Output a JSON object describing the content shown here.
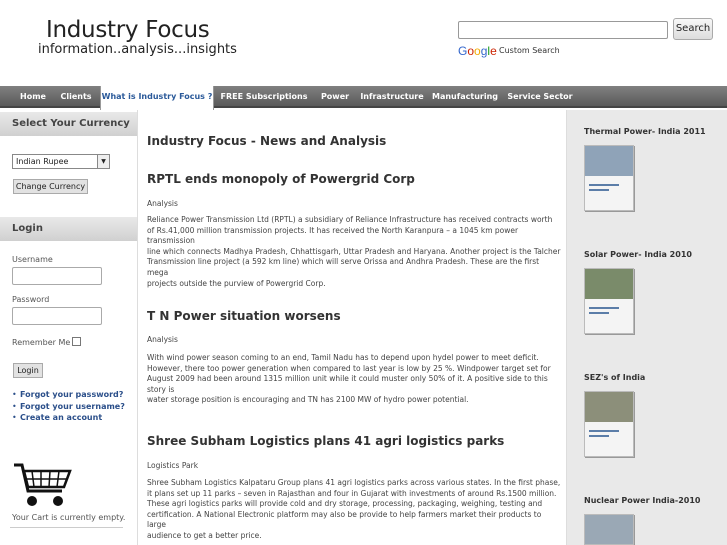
{
  "header": {
    "title": "Industry Focus",
    "tagline": "information..analysis...insights",
    "search_button": "Search",
    "google_letters": [
      "G",
      "o",
      "o",
      "g",
      "l",
      "e"
    ],
    "custom_search": "Custom Search"
  },
  "nav": {
    "items": [
      {
        "label": "Home"
      },
      {
        "label": "Clients"
      },
      {
        "label": "What is Industry Focus ?"
      },
      {
        "label": "FREE Subscriptions"
      },
      {
        "label": "Power"
      },
      {
        "label": "Infrastructure"
      },
      {
        "label": "Manufacturing"
      },
      {
        "label": "Service Sector"
      }
    ],
    "active_index": 2
  },
  "left": {
    "currency_head": "Select Your Currency",
    "currency_selected": "Indian Rupee",
    "change_currency": "Change Currency",
    "login_head": "Login",
    "username_label": "Username",
    "password_label": "Password",
    "remember_label": "Remember Me",
    "login_button": "Login",
    "links": [
      "Forgot your password?",
      "Forgot your username?",
      "Create an account"
    ],
    "cart_text": "Your Cart is currently empty."
  },
  "main": {
    "title": "Industry Focus - News and Analysis",
    "articles": [
      {
        "title": "RPTL ends monopoly of Powergrid Corp",
        "category": "Analysis",
        "lines": [
          "Reliance Power Transmission Ltd (RPTL) a subsidiary of Reliance Infrastructure has received contracts worth",
          "of Rs.41,000 million transmission projects. It has received the North Karanpura – a 1045 km power transmission",
          "line which connects Madhya Pradesh, Chhattisgarh, Uttar Pradesh and Haryana. Another project is the Talcher",
          "Transmission line project (a 592 km line) which will serve Orissa and Andhra Pradesh. These are the first mega",
          "projects outside the purview of Powergrid Corp."
        ]
      },
      {
        "title": "T N Power situation worsens",
        "category": "Analysis",
        "lines": [
          "With wind power season coming to an end, Tamil Nadu has to depend upon hydel power to meet deficit.",
          "However, there too power generation when compared to last year is low by 25 %. Windpower target set for",
          "August 2009 had been around 1315 million unit while it could muster only 50% of it. A positive side to this story is",
          "water storage position is encouraging and TN has 2100 MW of hydro power potential."
        ]
      },
      {
        "title": "Shree Subham Logistics plans 41 agri logistics parks",
        "category": "Logistics Park",
        "lines": [
          "Shree Subham Logistics Kalpataru Group plans 41 agri logistics parks across various states. In the first phase,",
          "it plans set up 11 parks – seven in Rajasthan and four in Gujarat with investments of around Rs.1500 million.",
          "These agri logistics parks will provide cold and dry storage, processing, packaging, weighing, testing and",
          "certification. A National Electronic platform may also be provide to help farmers market their products to large",
          "audience to get a better price."
        ]
      }
    ]
  },
  "right": {
    "books": [
      {
        "title": "Thermal Power- India 2011",
        "img_color": "#8fa3b8"
      },
      {
        "title": "Solar Power- India 2010",
        "img_color": "#7a8b6a"
      },
      {
        "title": "SEZ's of India",
        "img_color": "#8c8f7a"
      },
      {
        "title": "Nuclear Power India-2010",
        "img_color": "#9aa8b5"
      }
    ]
  },
  "colors": {
    "nav_active_text": "#2b5a9a",
    "link": "#2b4f8a",
    "right_bg": "#e9e9e9"
  }
}
